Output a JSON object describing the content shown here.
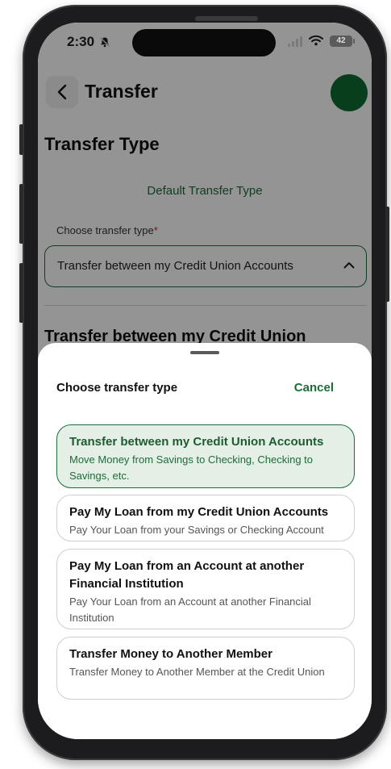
{
  "status_bar": {
    "time": "2:30",
    "battery": "42"
  },
  "header": {
    "title": "Transfer"
  },
  "page": {
    "section_title": "Transfer Type",
    "default_type_label": "Default Transfer Type",
    "field_label": "Choose transfer type",
    "required_mark": "*",
    "selected_value": "Transfer between my Credit Union Accounts",
    "partial_section_title": "Transfer between my Credit Union"
  },
  "sheet": {
    "title": "Choose transfer type",
    "cancel_label": "Cancel",
    "options": [
      {
        "title": "Transfer between my Credit Union Accounts",
        "description": "Move Money from Savings to Checking, Checking to Savings, etc.",
        "selected": true
      },
      {
        "title": "Pay My Loan from my Credit Union Accounts",
        "description": "Pay Your Loan from your Savings or Checking Account",
        "selected": false
      },
      {
        "title": "Pay My Loan from an Account at another Financial Institution",
        "description": "Pay Your Loan from an Account at another Financial Institution",
        "selected": false
      },
      {
        "title": "Transfer Money to Another Member",
        "description": "Transfer Money to Another Member at the Credit Union",
        "selected": false
      }
    ]
  },
  "colors": {
    "brand_green": "#1e6b3a",
    "avatar_green": "#0e6b30",
    "selected_bg": "#e4efe6"
  },
  "icons": {
    "back": "chevron-left-icon",
    "select_chevron": "chevron-up-icon",
    "mute": "bell-slash-icon",
    "wifi": "wifi-icon",
    "signal": "cellular-signal-icon",
    "battery": "battery-icon"
  }
}
